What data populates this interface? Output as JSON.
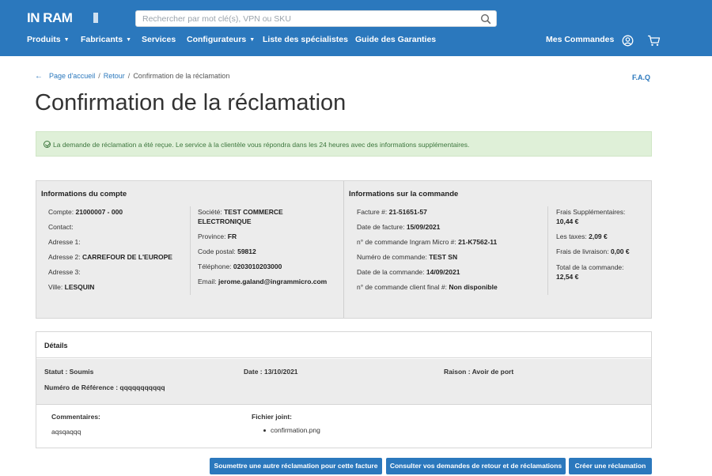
{
  "brand": {
    "logo_text": "IN RAM"
  },
  "search": {
    "placeholder": "Rechercher par mot clé(s), VPN ou SKU"
  },
  "nav": {
    "items": [
      {
        "label": "Produits",
        "has_caret": true
      },
      {
        "label": "Fabricants",
        "has_caret": true
      },
      {
        "label": "Services",
        "has_caret": false
      },
      {
        "label": "Configurateurs",
        "has_caret": true
      },
      {
        "label": "Liste des spécialistes",
        "has_caret": false
      },
      {
        "label": "Guide des Garanties",
        "has_caret": false
      }
    ],
    "orders_label": "Mes Commandes",
    "caret": "▼"
  },
  "breadcrumb": {
    "arrow": "←",
    "home": "Page d'accueil",
    "back": "Retour",
    "current": "Confirmation de la réclamation",
    "sep": "/"
  },
  "faq": "F.A.Q",
  "page_title": "Confirmation de la réclamation",
  "alert": {
    "message": "La demande de réclamation a été reçue. Le service à la clientèle vous répondra dans les 24 heures avec des informations supplémentaires."
  },
  "account": {
    "title": "Informations du compte",
    "left": [
      {
        "label": "Compte: ",
        "value": "21000007 - 000"
      },
      {
        "label": "Contact:",
        "value": ""
      },
      {
        "label": "Adresse 1:",
        "value": ""
      },
      {
        "label": "Adresse 2: ",
        "value": "CARREFOUR DE L'EUROPE"
      },
      {
        "label": "Adresse 3:",
        "value": ""
      },
      {
        "label": "Ville: ",
        "value": "LESQUIN"
      }
    ],
    "right": {
      "company_label": "Société: ",
      "company_line1": "TEST COMMERCE",
      "company_line2": "ELECTRONIQUE",
      "fields": [
        {
          "label": "Province: ",
          "value": "FR"
        },
        {
          "label": "Code postal: ",
          "value": "59812"
        },
        {
          "label": "Téléphone: ",
          "value": "0203010203000"
        },
        {
          "label": "Email: ",
          "value": "jerome.galand@ingrammicro.com"
        }
      ]
    }
  },
  "order": {
    "title": "Informations sur la commande",
    "fields": [
      {
        "label": "Facture #: ",
        "value": "21-51651-57"
      },
      {
        "label": "Date de facture: ",
        "value": "15/09/2021"
      },
      {
        "label": "n° de commande Ingram Micro #: ",
        "value": "21-K7562-11"
      },
      {
        "label": "Numéro de commande: ",
        "value": "TEST SN"
      },
      {
        "label": "Date de la commande: ",
        "value": "14/09/2021"
      },
      {
        "label": "n° de commande client final #: ",
        "value": "Non disponible"
      }
    ],
    "fees": {
      "extra_label": "Frais Supplémentaires:",
      "extra_value": "10,44 €",
      "tax_label": "Les taxes: ",
      "tax_value": "2,09 €",
      "delivery_label": "Frais de livraison: ",
      "delivery_value": "0,00 €",
      "total_label": "Total de la commande:",
      "total_value": "12,54 €"
    }
  },
  "details": {
    "title": "Détails",
    "status": "Statut : Soumis",
    "date": "Date : 13/10/2021",
    "reason": "Raison : Avoir de port",
    "reference": "Numéro de Référence : qqqqqqqqqqq",
    "comments_label": "Commentaires:",
    "comments_value": "aqsqaqqq",
    "attachment_label": "Fichier joint:",
    "attachment_file": "confirmation.png"
  },
  "buttons": {
    "another_claim": "Soumettre une autre réclamation pour cette facture",
    "view_returns": "Consulter vos demandes de retour et de réclamations",
    "create_claim": "Créer une réclamation"
  }
}
